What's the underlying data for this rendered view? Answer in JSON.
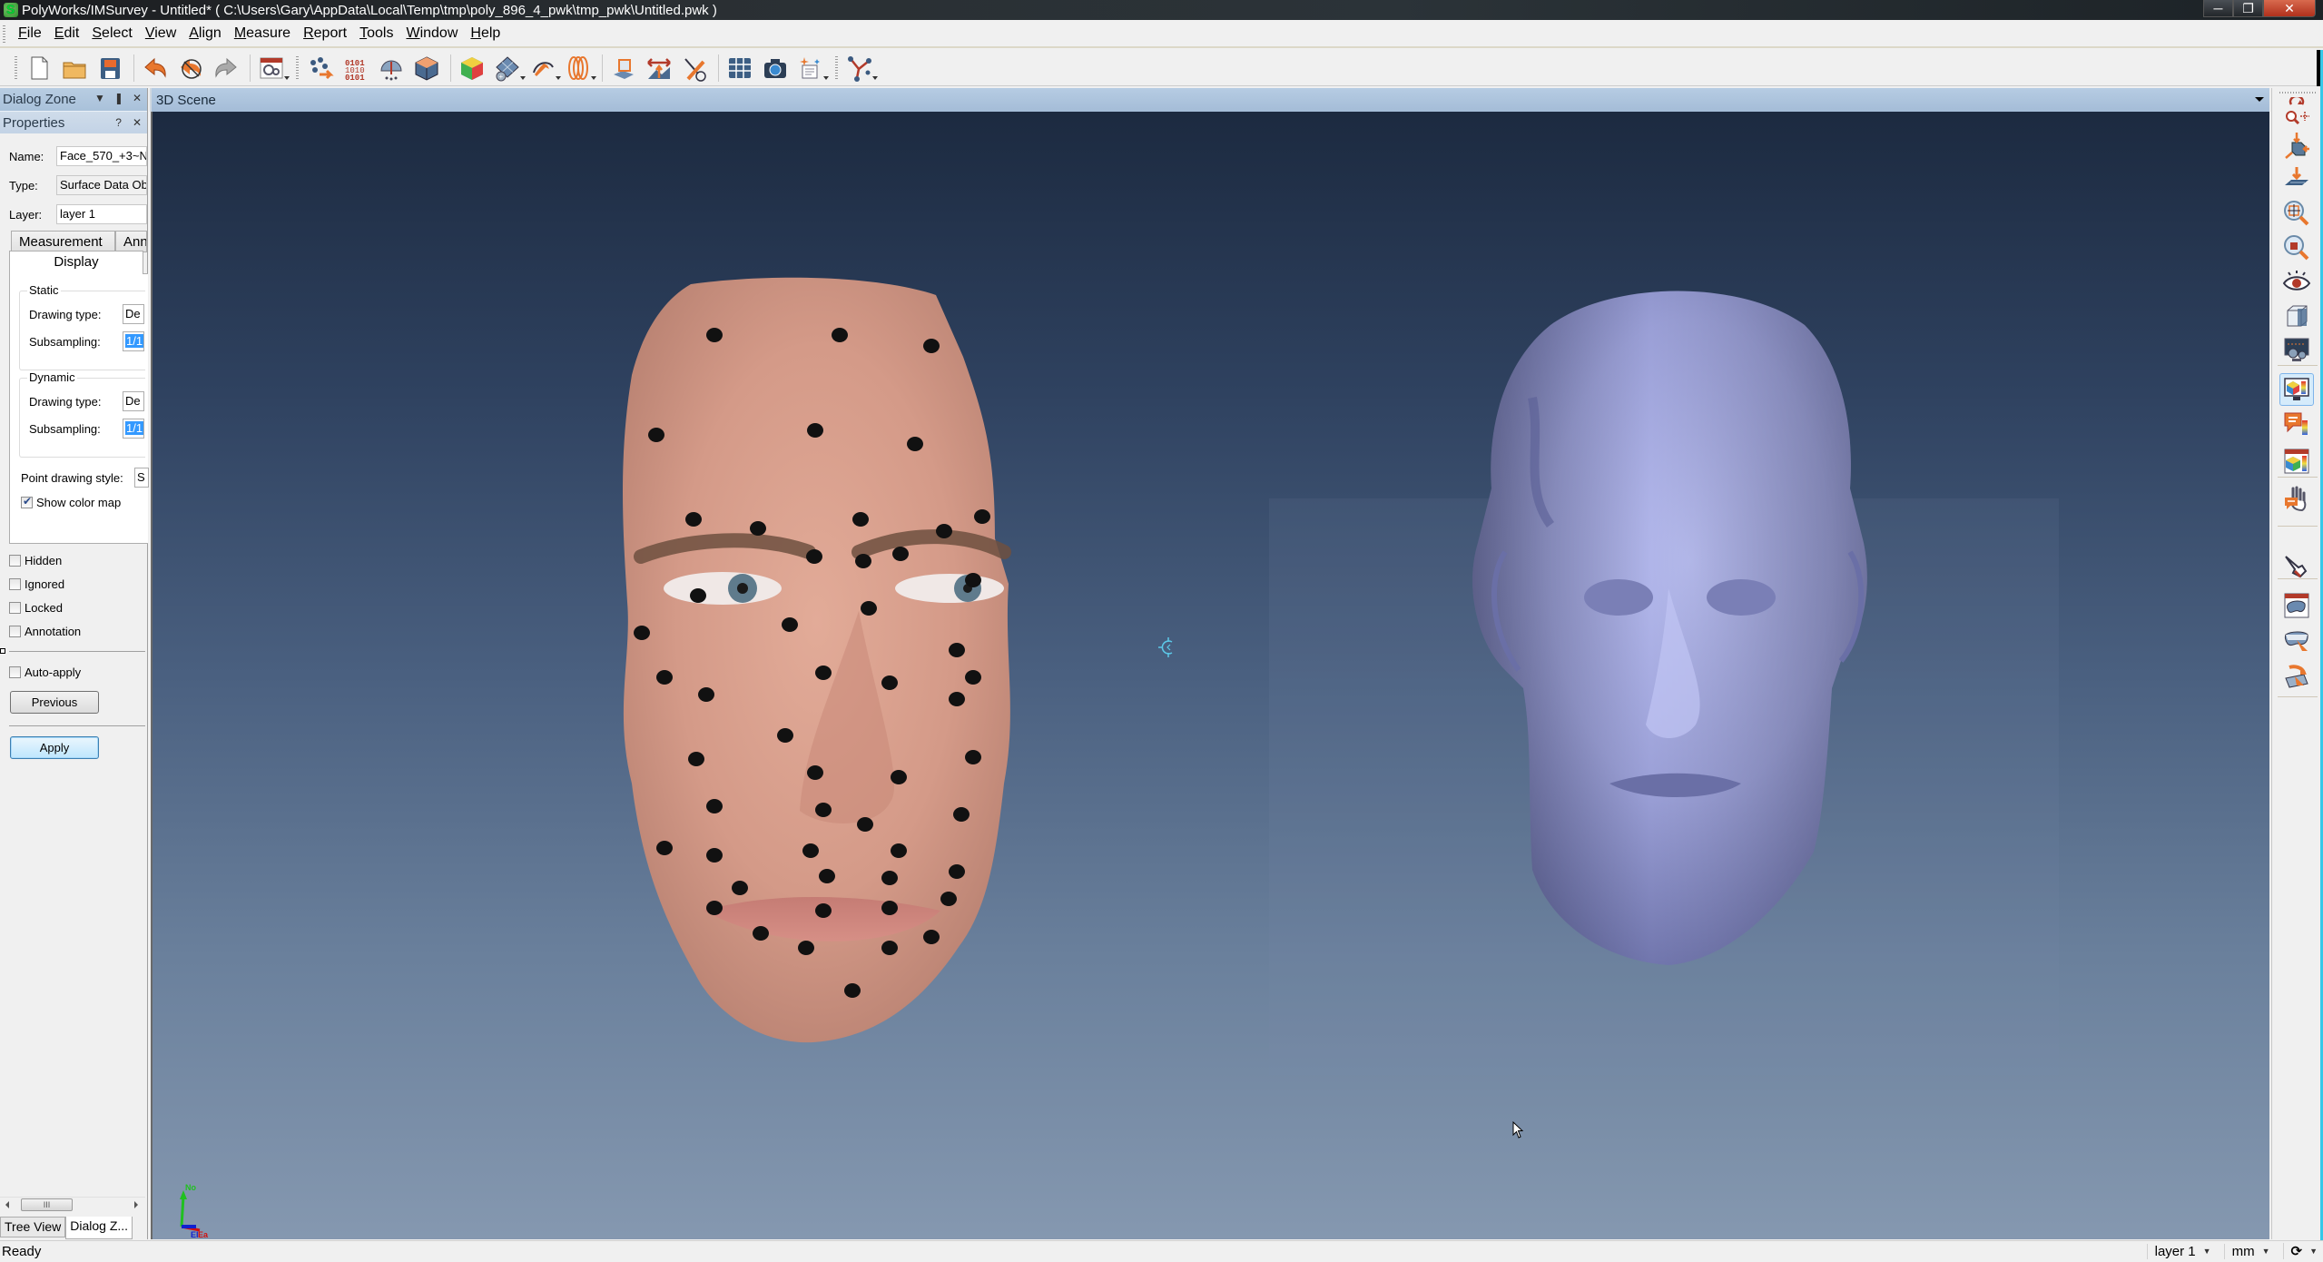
{
  "window": {
    "title": "PolyWorks/IMSurvey - Untitled* ( C:\\Users\\Gary\\AppData\\Local\\Temp\\tmp\\poly_896_4_pwk\\tmp_pwk\\Untitled.pwk )",
    "controls": [
      "minimize",
      "restore",
      "close"
    ]
  },
  "menu": [
    "File",
    "Edit",
    "Select",
    "View",
    "Align",
    "Measure",
    "Report",
    "Tools",
    "Window",
    "Help"
  ],
  "menu_mnemonics": [
    "F",
    "E",
    "S",
    "V",
    "A",
    "M",
    "R",
    "T",
    "W",
    "H"
  ],
  "toolbar": {
    "buttons": [
      {
        "name": "new-file",
        "icon": "new-document-icon"
      },
      {
        "name": "open-file",
        "icon": "open-folder-icon"
      },
      {
        "name": "save-file",
        "icon": "save-floppy-icon"
      },
      {
        "name": "undo",
        "icon": "undo-arrow-icon"
      },
      {
        "name": "undo-history",
        "icon": "undo-history-icon"
      },
      {
        "name": "redo",
        "icon": "redo-arrow-icon"
      },
      {
        "name": "options",
        "icon": "settings-window-icon"
      },
      {
        "name": "import-points",
        "icon": "point-cloud-import-icon"
      },
      {
        "name": "binary-data",
        "icon": "binary-data-icon"
      },
      {
        "name": "scan-probe",
        "icon": "scanner-icon"
      },
      {
        "name": "polygon-model",
        "icon": "polygon-cube-icon"
      },
      {
        "name": "color-map",
        "icon": "color-cube-icon"
      },
      {
        "name": "surface-create",
        "icon": "surface-grid-icon"
      },
      {
        "name": "curve-tools",
        "icon": "wrench-curve-icon"
      },
      {
        "name": "cross-sections",
        "icon": "cross-sections-icon"
      },
      {
        "name": "features",
        "icon": "plane-feature-icon"
      },
      {
        "name": "gap-flush",
        "icon": "gap-flush-icon"
      },
      {
        "name": "comparison",
        "icon": "measure-tool-icon"
      },
      {
        "name": "table",
        "icon": "table-grid-icon"
      },
      {
        "name": "snapshot",
        "icon": "camera-icon"
      },
      {
        "name": "report-items",
        "icon": "report-sparkle-icon"
      },
      {
        "name": "probing",
        "icon": "probe-devices-icon"
      }
    ]
  },
  "dialog_zone": {
    "title": "Dialog Zone",
    "properties_title": "Properties",
    "fields": {
      "name_label": "Name:",
      "name_value": "Face_570_+3~N",
      "type_label": "Type:",
      "type_value": "Surface Data Ob",
      "layer_label": "Layer:",
      "layer_value": "layer 1"
    },
    "tabs": [
      "Measurement",
      "Ann"
    ],
    "active_tab": "Display",
    "static_group": {
      "title": "Static",
      "drawing_type_label": "Drawing type:",
      "drawing_type_value": "De",
      "subsampling_label": "Subsampling:",
      "subsampling_value": "1/1"
    },
    "dynamic_group": {
      "title": "Dynamic",
      "drawing_type_label": "Drawing type:",
      "drawing_type_value": "De",
      "subsampling_label": "Subsampling:",
      "subsampling_value": "1/1"
    },
    "point_drawing_style_label": "Point drawing style:",
    "point_drawing_style_value": "S",
    "show_color_map_label": "Show color map",
    "show_color_map_checked": true,
    "flags": [
      {
        "label": "Hidden",
        "checked": false
      },
      {
        "label": "Ignored",
        "checked": false
      },
      {
        "label": "Locked",
        "checked": false
      },
      {
        "label": "Annotation",
        "checked": false
      }
    ],
    "auto_apply_label": "Auto-apply",
    "auto_apply_checked": false,
    "previous_label": "Previous",
    "apply_label": "Apply",
    "scroll_thumb": "III",
    "bottom_tabs": [
      "Tree View",
      "Dialog Z..."
    ],
    "active_bottom_tab": "Dialog Z..."
  },
  "scene": {
    "title": "3D Scene",
    "objects": [
      "textured-face-scan",
      "gray-mesh-head"
    ],
    "axis_labels": {
      "north": "No",
      "east": "Ea",
      "elevation": "El"
    },
    "colors": {
      "mesh": "#9a9fd6",
      "background_top": "#1c2a40",
      "background_bottom": "#8598b0",
      "skin": "#d8a090",
      "marker": "#111111"
    }
  },
  "right_toolbar": {
    "buttons": [
      {
        "name": "rotate-zoom-pan",
        "icon": "rotate-zoom-pan-icon"
      },
      {
        "name": "transform-box",
        "icon": "transform-cube-icon"
      },
      {
        "name": "project-plane",
        "icon": "project-plane-icon"
      },
      {
        "name": "zoom-fit",
        "icon": "zoom-fit-icon"
      },
      {
        "name": "zoom-object",
        "icon": "zoom-object-icon"
      },
      {
        "name": "visibility",
        "icon": "eye-icon"
      },
      {
        "name": "view-cube",
        "icon": "view-cube-icon"
      },
      {
        "name": "display-settings",
        "icon": "display-settings-icon"
      },
      {
        "name": "color-map-display",
        "icon": "color-map-display-icon",
        "active": true
      },
      {
        "name": "annotation-colors",
        "icon": "annotation-colors-icon"
      },
      {
        "name": "color-map-window",
        "icon": "color-map-window-icon"
      },
      {
        "name": "hand-annotation",
        "icon": "hand-annotation-icon"
      },
      {
        "name": "pointer-select",
        "icon": "pointer-hand-icon"
      },
      {
        "name": "shape-window",
        "icon": "shape-window-icon"
      },
      {
        "name": "shape-select",
        "icon": "shape-select-icon"
      },
      {
        "name": "plane-transform",
        "icon": "plane-transform-icon"
      }
    ]
  },
  "status": {
    "message": "Ready",
    "layer": "layer 1",
    "units": "mm"
  }
}
